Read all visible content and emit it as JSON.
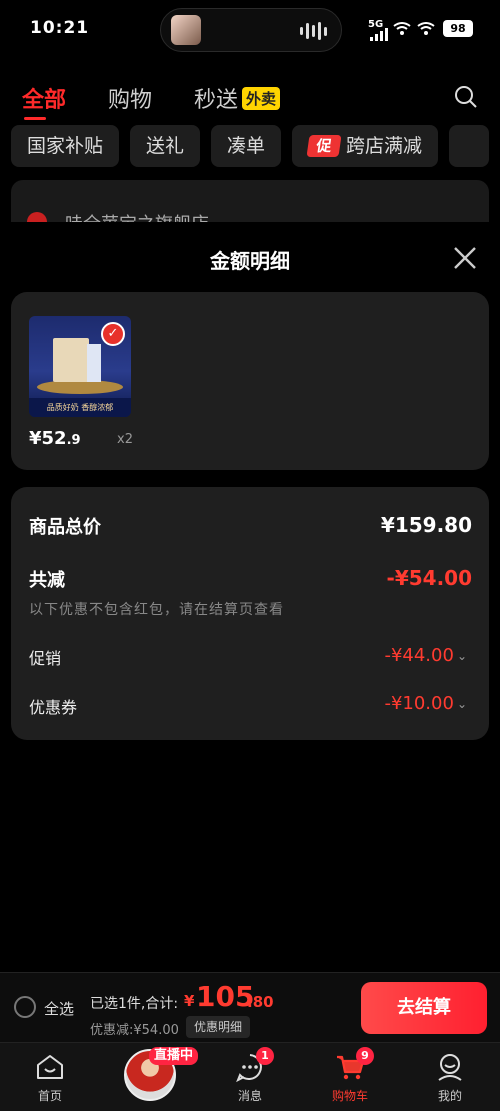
{
  "status": {
    "time": "10:21",
    "network": "5G",
    "battery": "98"
  },
  "top_tabs": [
    {
      "label": "全部"
    },
    {
      "label": "购物"
    },
    {
      "label": "秒送",
      "badge": "外卖"
    }
  ],
  "chips": [
    {
      "label": "国家补贴"
    },
    {
      "label": "送礼"
    },
    {
      "label": "凑单"
    },
    {
      "label": "跨店满减",
      "tag": "促"
    }
  ],
  "behind_text": "哇全苹宝之旗舰店",
  "sheet": {
    "title": "金额明细",
    "product": {
      "image_band_text": "品质好奶 香醇浓郁",
      "price_int": "¥52",
      "price_dec": ".9",
      "qty": "x2"
    },
    "summary": {
      "total_label": "商品总价",
      "total_value": "¥159.80",
      "reduce_label": "共减",
      "reduce_value": "-¥54.00",
      "note": "以下优惠不包含红包，请在结算页查看",
      "promo_label": "促销",
      "promo_value": "-¥44.00",
      "coupon_label": "优惠券",
      "coupon_value": "-¥10.00"
    }
  },
  "checkout": {
    "select_all": "全选",
    "selected_info": "已选1件,合计:",
    "yen": "¥",
    "total_int": "105",
    "total_dec": ".80",
    "discount": "优惠减:¥54.00",
    "detail_label": "优惠明细",
    "pay_label": "去结算"
  },
  "nav": [
    {
      "label": "首页"
    },
    {
      "label": "",
      "live": "直播中"
    },
    {
      "label": "消息",
      "badge": "1"
    },
    {
      "label": "购物车",
      "badge": "9"
    },
    {
      "label": "我的"
    }
  ],
  "colors": {
    "accent": "#ff3b30",
    "pay": "#ff2030",
    "waimai": "#ffd400"
  }
}
